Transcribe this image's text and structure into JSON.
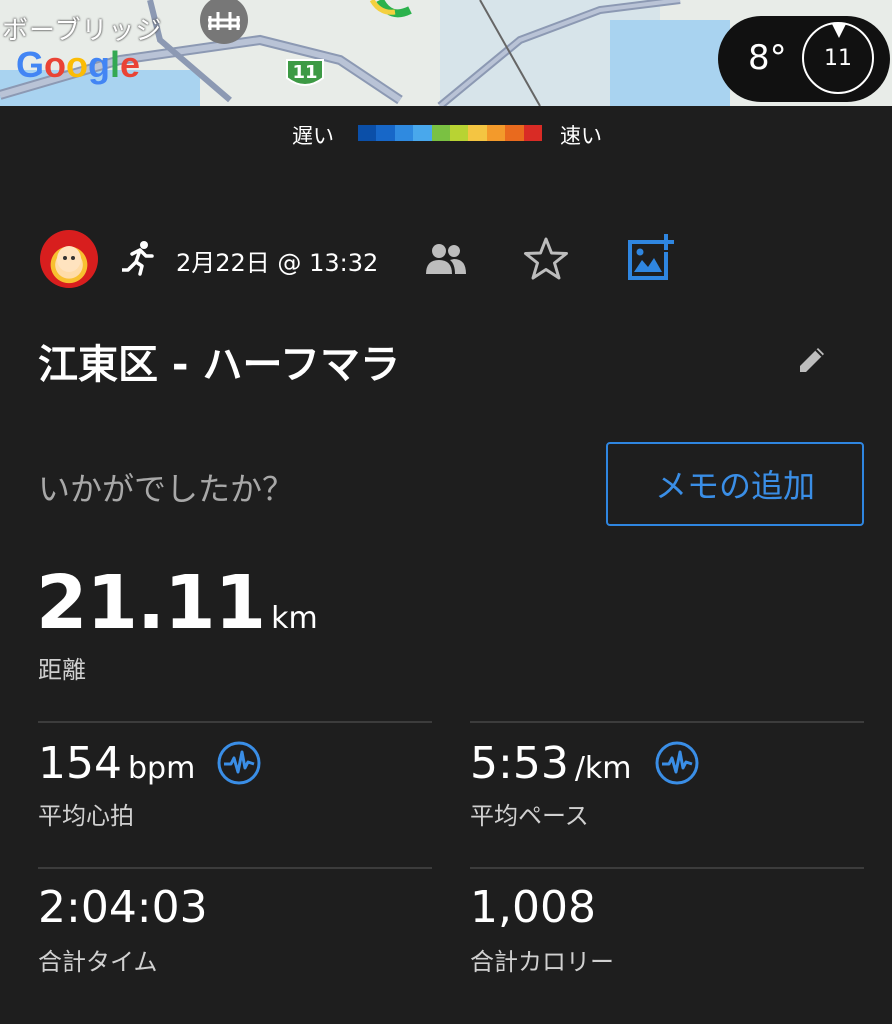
{
  "map": {
    "place_label": "ボーブリッジ",
    "google_logo": [
      "G",
      "o",
      "o",
      "g",
      "l",
      "e"
    ],
    "route_number": "11",
    "weather": {
      "temperature": "8°",
      "wind": "11"
    }
  },
  "pace_legend": {
    "slow_label": "遅い",
    "fast_label": "速い",
    "colors": [
      "#0b4fa8",
      "#1767c8",
      "#2f8ae0",
      "#49a8ec",
      "#7ac142",
      "#b8d333",
      "#f4c542",
      "#f39a2b",
      "#e96a1e",
      "#d92b25"
    ]
  },
  "activity": {
    "date": "2月22日 @ 13:32",
    "title": "江東区 - ハーフマラ",
    "prompt": "いかがでしたか？",
    "memo_button": "メモの追加"
  },
  "stats": {
    "distance": {
      "value": "21.11",
      "unit": "km",
      "label": "距離"
    },
    "avg_hr": {
      "value": "154",
      "unit": "bpm",
      "label": "平均心拍"
    },
    "avg_pace": {
      "value": "5:53",
      "unit": "/km",
      "label": "平均ペース"
    },
    "total_time": {
      "value": "2:04:03",
      "label": "合計タイム"
    },
    "calories": {
      "value": "1,008",
      "label": "合計カロリー"
    }
  },
  "colors": {
    "accent": "#2f86e0",
    "background": "#1e1e1e"
  }
}
